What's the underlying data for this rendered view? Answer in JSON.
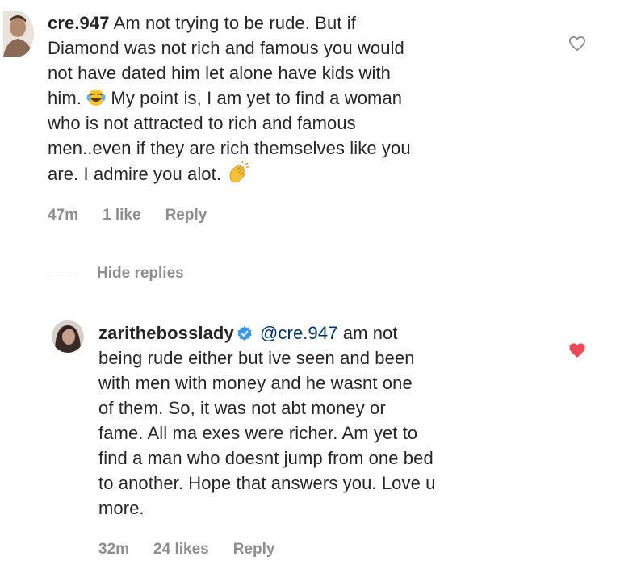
{
  "comments": [
    {
      "username": "cre.947",
      "text_lines": [
        "Am not trying to be rude. But if",
        "Diamond was not rich and famous you would",
        "not have dated him let alone have kids with",
        "him.",
        "My point is, I am yet to find a woman",
        "who is not attracted to rich and famous",
        "men..even if they are rich themselves like you",
        "are. I admire you alot."
      ],
      "time": "47m",
      "likes": "1 like",
      "reply_label": "Reply",
      "liked": false
    },
    {
      "username": "zarithebosslady",
      "mention": "@cre.947",
      "text_lines": [
        "am not",
        "being rude either but ive seen and been",
        "with  men with money and he wasnt one",
        "of them. So, it was not abt money or",
        "fame. All ma exes were richer. Am yet to",
        "find a man who doesnt jump from one bed",
        "to another. Hope that answers you. Love u",
        "more."
      ],
      "time": "32m",
      "likes": "24 likes",
      "reply_label": "Reply",
      "liked": true
    }
  ],
  "hide_replies_label": "Hide replies",
  "icons": {
    "laugh_emoji": "face-with-tears-of-joy",
    "clap_emoji": "clapping-hands",
    "heart_outline": "heart-outline-icon",
    "heart_filled": "heart-filled-icon",
    "verified": "verified-badge-icon"
  },
  "colors": {
    "heart_liked": "#ed4956",
    "heart_outline": "#8e8e8e",
    "verified": "#3897f0",
    "meta_text": "#8e8e8e"
  }
}
